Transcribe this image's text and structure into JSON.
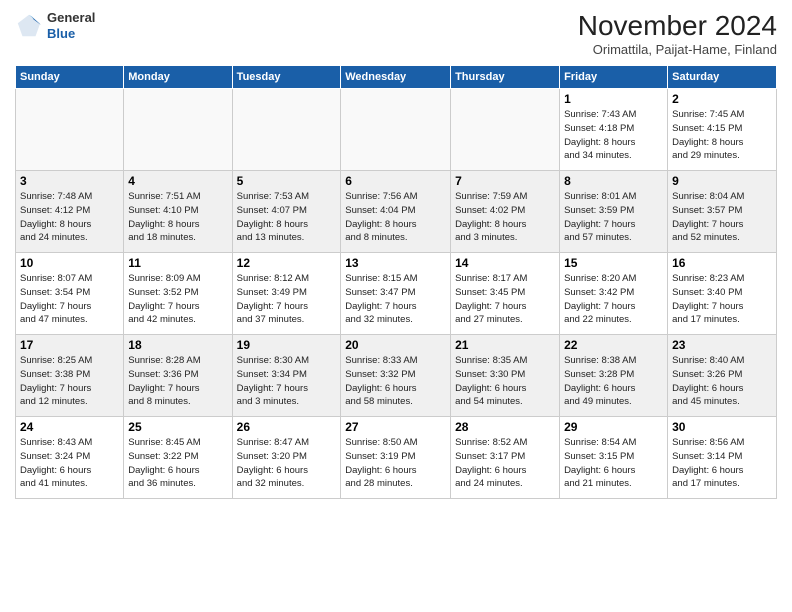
{
  "logo": {
    "line1": "General",
    "line2": "Blue"
  },
  "title": "November 2024",
  "subtitle": "Orimattila, Paijat-Hame, Finland",
  "days_of_week": [
    "Sunday",
    "Monday",
    "Tuesday",
    "Wednesday",
    "Thursday",
    "Friday",
    "Saturday"
  ],
  "weeks": [
    [
      {
        "day": "",
        "info": ""
      },
      {
        "day": "",
        "info": ""
      },
      {
        "day": "",
        "info": ""
      },
      {
        "day": "",
        "info": ""
      },
      {
        "day": "",
        "info": ""
      },
      {
        "day": "1",
        "info": "Sunrise: 7:43 AM\nSunset: 4:18 PM\nDaylight: 8 hours\nand 34 minutes."
      },
      {
        "day": "2",
        "info": "Sunrise: 7:45 AM\nSunset: 4:15 PM\nDaylight: 8 hours\nand 29 minutes."
      }
    ],
    [
      {
        "day": "3",
        "info": "Sunrise: 7:48 AM\nSunset: 4:12 PM\nDaylight: 8 hours\nand 24 minutes."
      },
      {
        "day": "4",
        "info": "Sunrise: 7:51 AM\nSunset: 4:10 PM\nDaylight: 8 hours\nand 18 minutes."
      },
      {
        "day": "5",
        "info": "Sunrise: 7:53 AM\nSunset: 4:07 PM\nDaylight: 8 hours\nand 13 minutes."
      },
      {
        "day": "6",
        "info": "Sunrise: 7:56 AM\nSunset: 4:04 PM\nDaylight: 8 hours\nand 8 minutes."
      },
      {
        "day": "7",
        "info": "Sunrise: 7:59 AM\nSunset: 4:02 PM\nDaylight: 8 hours\nand 3 minutes."
      },
      {
        "day": "8",
        "info": "Sunrise: 8:01 AM\nSunset: 3:59 PM\nDaylight: 7 hours\nand 57 minutes."
      },
      {
        "day": "9",
        "info": "Sunrise: 8:04 AM\nSunset: 3:57 PM\nDaylight: 7 hours\nand 52 minutes."
      }
    ],
    [
      {
        "day": "10",
        "info": "Sunrise: 8:07 AM\nSunset: 3:54 PM\nDaylight: 7 hours\nand 47 minutes."
      },
      {
        "day": "11",
        "info": "Sunrise: 8:09 AM\nSunset: 3:52 PM\nDaylight: 7 hours\nand 42 minutes."
      },
      {
        "day": "12",
        "info": "Sunrise: 8:12 AM\nSunset: 3:49 PM\nDaylight: 7 hours\nand 37 minutes."
      },
      {
        "day": "13",
        "info": "Sunrise: 8:15 AM\nSunset: 3:47 PM\nDaylight: 7 hours\nand 32 minutes."
      },
      {
        "day": "14",
        "info": "Sunrise: 8:17 AM\nSunset: 3:45 PM\nDaylight: 7 hours\nand 27 minutes."
      },
      {
        "day": "15",
        "info": "Sunrise: 8:20 AM\nSunset: 3:42 PM\nDaylight: 7 hours\nand 22 minutes."
      },
      {
        "day": "16",
        "info": "Sunrise: 8:23 AM\nSunset: 3:40 PM\nDaylight: 7 hours\nand 17 minutes."
      }
    ],
    [
      {
        "day": "17",
        "info": "Sunrise: 8:25 AM\nSunset: 3:38 PM\nDaylight: 7 hours\nand 12 minutes."
      },
      {
        "day": "18",
        "info": "Sunrise: 8:28 AM\nSunset: 3:36 PM\nDaylight: 7 hours\nand 8 minutes."
      },
      {
        "day": "19",
        "info": "Sunrise: 8:30 AM\nSunset: 3:34 PM\nDaylight: 7 hours\nand 3 minutes."
      },
      {
        "day": "20",
        "info": "Sunrise: 8:33 AM\nSunset: 3:32 PM\nDaylight: 6 hours\nand 58 minutes."
      },
      {
        "day": "21",
        "info": "Sunrise: 8:35 AM\nSunset: 3:30 PM\nDaylight: 6 hours\nand 54 minutes."
      },
      {
        "day": "22",
        "info": "Sunrise: 8:38 AM\nSunset: 3:28 PM\nDaylight: 6 hours\nand 49 minutes."
      },
      {
        "day": "23",
        "info": "Sunrise: 8:40 AM\nSunset: 3:26 PM\nDaylight: 6 hours\nand 45 minutes."
      }
    ],
    [
      {
        "day": "24",
        "info": "Sunrise: 8:43 AM\nSunset: 3:24 PM\nDaylight: 6 hours\nand 41 minutes."
      },
      {
        "day": "25",
        "info": "Sunrise: 8:45 AM\nSunset: 3:22 PM\nDaylight: 6 hours\nand 36 minutes."
      },
      {
        "day": "26",
        "info": "Sunrise: 8:47 AM\nSunset: 3:20 PM\nDaylight: 6 hours\nand 32 minutes."
      },
      {
        "day": "27",
        "info": "Sunrise: 8:50 AM\nSunset: 3:19 PM\nDaylight: 6 hours\nand 28 minutes."
      },
      {
        "day": "28",
        "info": "Sunrise: 8:52 AM\nSunset: 3:17 PM\nDaylight: 6 hours\nand 24 minutes."
      },
      {
        "day": "29",
        "info": "Sunrise: 8:54 AM\nSunset: 3:15 PM\nDaylight: 6 hours\nand 21 minutes."
      },
      {
        "day": "30",
        "info": "Sunrise: 8:56 AM\nSunset: 3:14 PM\nDaylight: 6 hours\nand 17 minutes."
      }
    ]
  ]
}
